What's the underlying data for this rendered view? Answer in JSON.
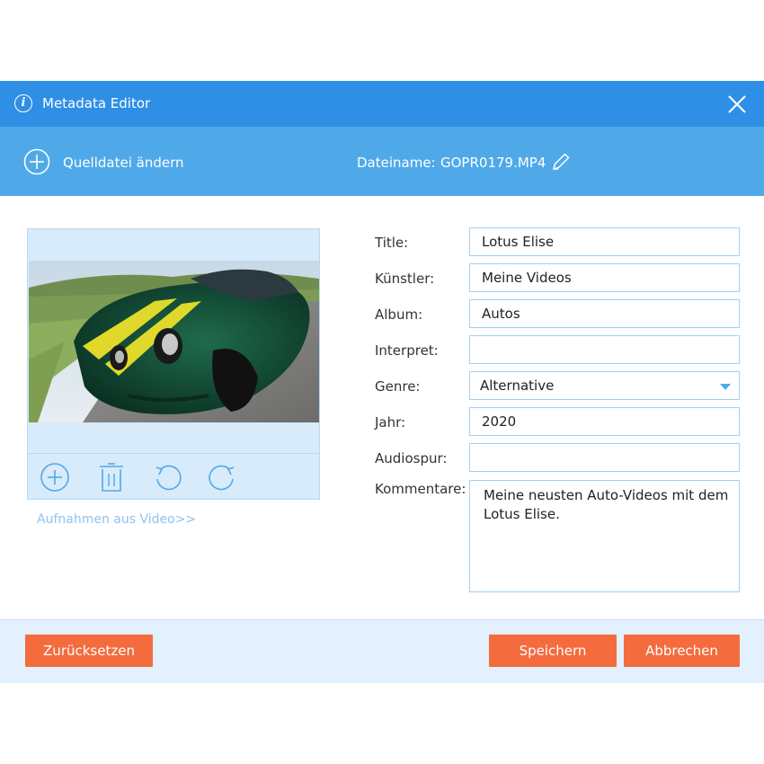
{
  "window": {
    "title": "Metadata Editor",
    "close_icon": "close-icon",
    "info_icon": "info-icon"
  },
  "source_bar": {
    "change_source_label": "Quelldatei ändern",
    "filename_label": "Dateiname:",
    "filename": "GOPR0179.MP4",
    "edit_icon": "pencil-icon"
  },
  "preview": {
    "image_alt": "green sports car with yellow stripes",
    "controls": [
      "add-icon",
      "trash-icon",
      "rotate-left-icon",
      "rotate-right-icon"
    ],
    "capture_link": "Aufnahmen aus Video>>"
  },
  "form": {
    "title_label": "Title:",
    "title_value": "Lotus Elise",
    "artist_label": "Künstler:",
    "artist_value": "Meine Videos",
    "album_label": "Album:",
    "album_value": "Autos",
    "performer_label": "Interpret:",
    "performer_value": "",
    "genre_label": "Genre:",
    "genre_value": "Alternative",
    "year_label": "Jahr:",
    "year_value": "2020",
    "track_label": "Audiospur:",
    "track_value": "",
    "comment_label": "Kommentare:",
    "comment_value": "Meine neusten Auto-Videos mit dem Lotus Elise."
  },
  "footer": {
    "reset_label": "Zurücksetzen",
    "save_label": "Speichern",
    "cancel_label": "Abbrechen"
  },
  "colors": {
    "titlebar": "#2f8fe6",
    "subbar": "#4fa9e9",
    "button": "#f46b3d",
    "footer": "#e3f0fd"
  }
}
